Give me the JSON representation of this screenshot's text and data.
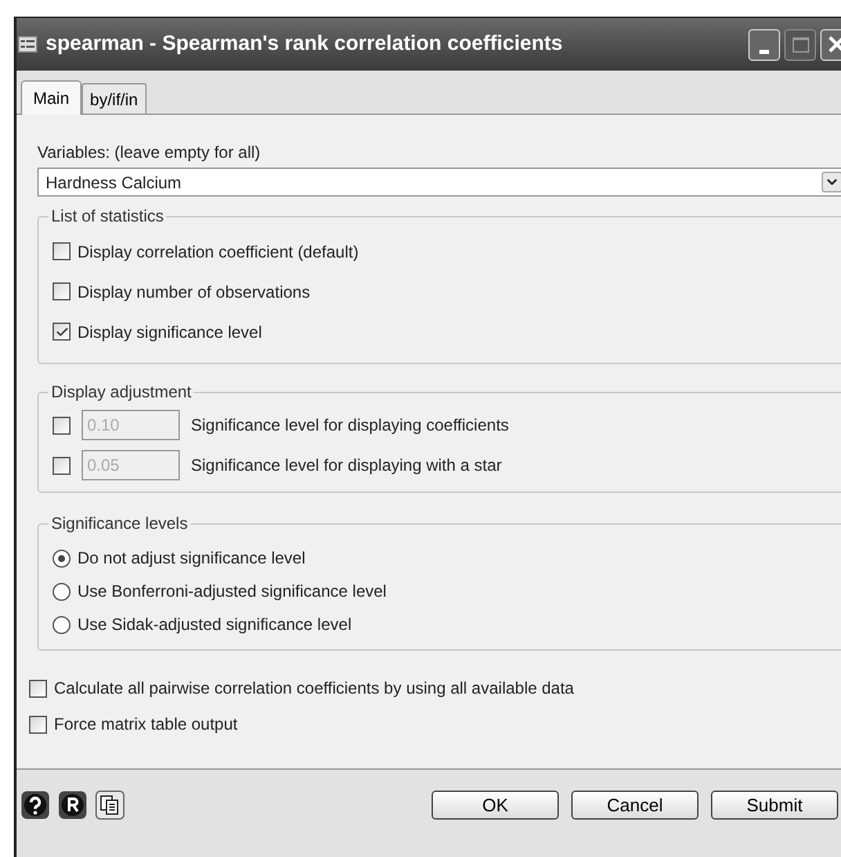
{
  "window": {
    "title": "spearman - Spearman's rank correlation coefficients"
  },
  "tabs": [
    {
      "label": "Main",
      "selected": true
    },
    {
      "label": "by/if/in",
      "selected": false
    }
  ],
  "variables": {
    "label": "Variables: (leave empty for all)",
    "value": "Hardness Calcium"
  },
  "list_of_statistics": {
    "title": "List of statistics",
    "items": [
      {
        "label": "Display correlation coefficient (default)",
        "checked": false
      },
      {
        "label": "Display number of observations",
        "checked": false
      },
      {
        "label": "Display significance level",
        "checked": true
      }
    ]
  },
  "display_adjustment": {
    "title": "Display adjustment",
    "items": [
      {
        "value": "0.10",
        "label": "Significance level for displaying coefficients",
        "checked": false,
        "disabled": true
      },
      {
        "value": "0.05",
        "label": "Significance level for displaying with a star",
        "checked": false,
        "disabled": true
      }
    ]
  },
  "significance_levels": {
    "title": "Significance levels",
    "options": [
      {
        "label": "Do not adjust significance level",
        "selected": true
      },
      {
        "label": "Use Bonferroni-adjusted significance level",
        "selected": false
      },
      {
        "label": "Use Sidak-adjusted significance level",
        "selected": false
      }
    ]
  },
  "options": [
    {
      "label": "Calculate all pairwise correlation coefficients by using all available data",
      "checked": false
    },
    {
      "label": "Force matrix table output",
      "checked": false
    }
  ],
  "buttons": [
    "OK",
    "Cancel",
    "Submit"
  ]
}
